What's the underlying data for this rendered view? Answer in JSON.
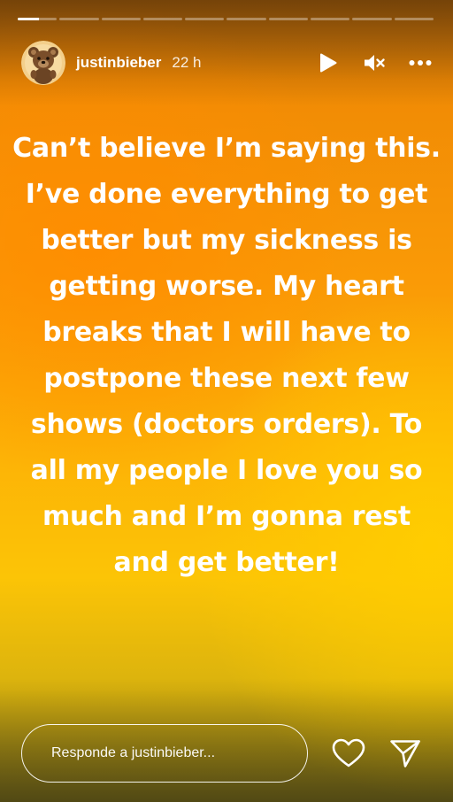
{
  "story": {
    "segment_count": 10,
    "active_segment_index": 0,
    "active_segment_progress": 0.55
  },
  "header": {
    "username": "justinbieber",
    "time_ago": "22 h",
    "avatar_icon": "teddy-bear-avatar-icon",
    "play_icon": "play-icon",
    "mute_icon": "speaker-muted-icon",
    "more_icon": "more-horizontal-icon"
  },
  "caption": {
    "text": "Can’t believe I’m saying this. I’ve done everything to get better but my sickness is getting worse. My heart breaks that I will have to postpone these next few shows (doctors orders). To all my people I love you so much and I’m gonna rest and get better!"
  },
  "reply": {
    "placeholder": "Responde a justinbieber..."
  },
  "actions": {
    "like_icon": "heart-icon",
    "share_icon": "send-icon"
  },
  "colors": {
    "gradient_top": "#f08a05",
    "gradient_mid": "#fdb106",
    "gradient_bottom": "#fcc406",
    "text": "#ffffff"
  }
}
